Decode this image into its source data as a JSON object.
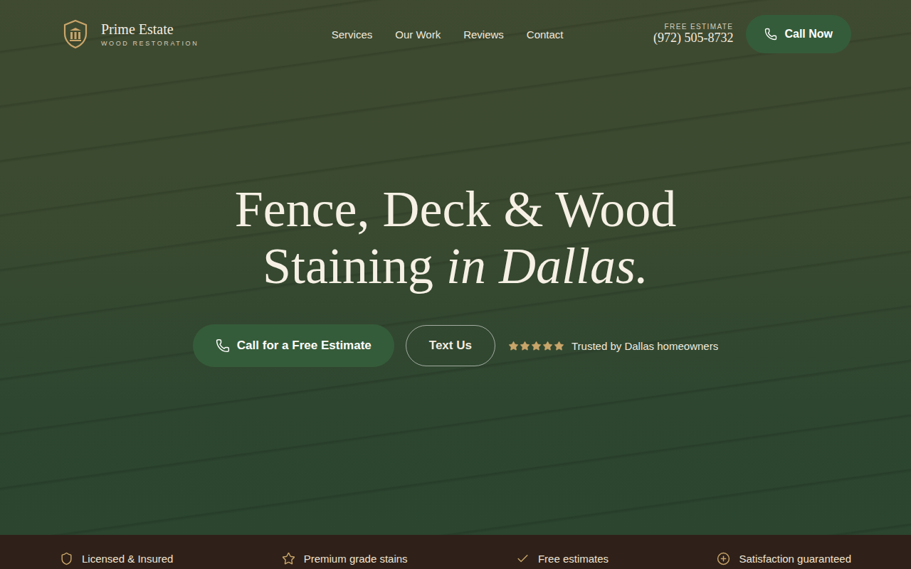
{
  "brand": {
    "name": "Prime Estate",
    "tagline": "WOOD RESTORATION"
  },
  "nav": [
    {
      "label": "Services"
    },
    {
      "label": "Our Work"
    },
    {
      "label": "Reviews"
    },
    {
      "label": "Contact"
    }
  ],
  "header_contact": {
    "label": "FREE ESTIMATE",
    "phone": "(972) 505-8732",
    "button": "Call Now"
  },
  "hero": {
    "title_line1": "Fence, Deck & Wood",
    "title_line2": "Staining",
    "title_italic": "in Dallas.",
    "primary_button": "Call for a Free Estimate",
    "secondary_button": "Text Us",
    "rating": {
      "stars": 5,
      "text": "Trusted by Dallas homeowners"
    }
  },
  "features": [
    {
      "label": "Licensed & Insured",
      "kind": "shield"
    },
    {
      "label": "Premium grade stains",
      "kind": "star"
    },
    {
      "label": "Free estimates",
      "kind": "check"
    },
    {
      "label": "Satisfaction guaranteed",
      "kind": "plus"
    }
  ]
}
